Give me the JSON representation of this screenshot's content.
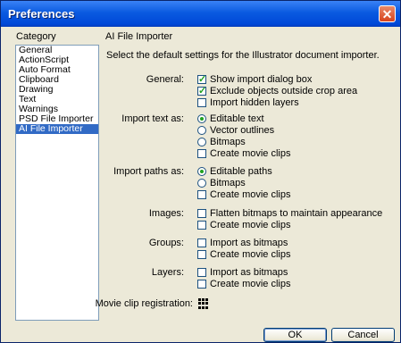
{
  "window": {
    "title": "Preferences",
    "close_icon": "close-icon"
  },
  "categories": {
    "header": "Category",
    "items": [
      "General",
      "ActionScript",
      "Auto Format",
      "Clipboard",
      "Drawing",
      "Text",
      "Warnings",
      "PSD File Importer",
      "AI File Importer"
    ],
    "selected": "AI File Importer"
  },
  "pane": {
    "header": "AI File Importer",
    "description": "Select the default settings for the Illustrator document importer.",
    "general": {
      "label": "General:",
      "opts": [
        {
          "label": "Show import dialog box",
          "checked": true
        },
        {
          "label": "Exclude objects outside crop area",
          "checked": true
        },
        {
          "label": "Import hidden layers",
          "checked": false
        }
      ]
    },
    "import_text": {
      "label": "Import text as:",
      "radios": [
        {
          "label": "Editable text",
          "selected": true
        },
        {
          "label": "Vector outlines",
          "selected": false
        },
        {
          "label": "Bitmaps",
          "selected": false
        }
      ],
      "movie_clips": "Create movie clips"
    },
    "import_paths": {
      "label": "Import paths as:",
      "radios": [
        {
          "label": "Editable paths",
          "selected": true
        },
        {
          "label": "Bitmaps",
          "selected": false
        }
      ],
      "movie_clips": "Create movie clips"
    },
    "images": {
      "label": "Images:",
      "flatten": "Flatten bitmaps to maintain appearance",
      "movie_clips": "Create movie clips"
    },
    "groups": {
      "label": "Groups:",
      "as_bitmaps": "Import as bitmaps",
      "movie_clips": "Create movie clips"
    },
    "layers": {
      "label": "Layers:",
      "as_bitmaps": "Import as bitmaps",
      "movie_clips": "Create movie clips"
    },
    "registration": {
      "label": "Movie clip registration:",
      "icon": "registration-grid-icon"
    }
  },
  "buttons": {
    "ok": "OK",
    "cancel": "Cancel"
  }
}
